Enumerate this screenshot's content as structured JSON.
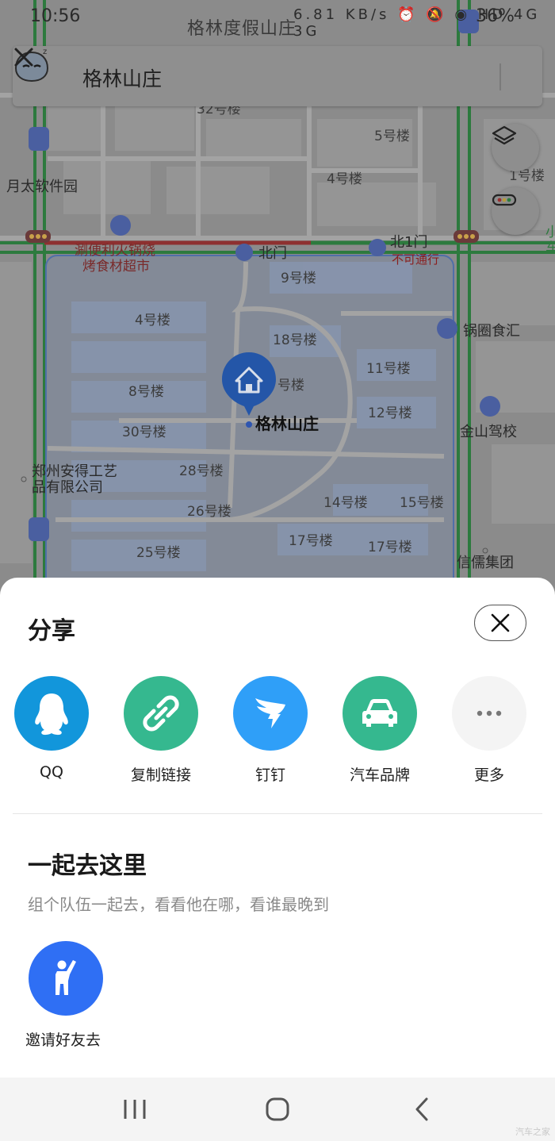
{
  "status_bar": {
    "time": "10:56",
    "map_title": "格林度假山庄",
    "icons_text": "6.81 KB/s ⏰ 🔕 ◉ HD 4G 3G",
    "battery": "36%"
  },
  "search": {
    "query": "格林山庄",
    "back_icon": "back-arrow-icon",
    "assistant_icon": "assistant-bot-icon",
    "clear_icon": "close-icon"
  },
  "map": {
    "labels": [
      {
        "text": "32号楼",
        "kind": "building"
      },
      {
        "text": "5号楼",
        "kind": "building"
      },
      {
        "text": "月太软件园",
        "kind": "poi"
      },
      {
        "text": "4号楼",
        "kind": "building"
      },
      {
        "text": "1号楼",
        "kind": "building"
      },
      {
        "text": "涮便利火锅烧",
        "kind": "red"
      },
      {
        "text": "烤食材超市",
        "kind": "red"
      },
      {
        "text": "北门",
        "kind": "poi"
      },
      {
        "text": "北1门",
        "kind": "poi"
      },
      {
        "text": "不可通行",
        "kind": "warn"
      },
      {
        "text": "9号楼",
        "kind": "building"
      },
      {
        "text": "4号楼",
        "kind": "building"
      },
      {
        "text": "18号楼",
        "kind": "building"
      },
      {
        "text": "锅圈食汇",
        "kind": "poi"
      },
      {
        "text": "11号楼",
        "kind": "building"
      },
      {
        "text": "8号楼",
        "kind": "building"
      },
      {
        "text": "号楼",
        "kind": "building"
      },
      {
        "text": "12号楼",
        "kind": "building"
      },
      {
        "text": "格林山庄",
        "kind": "selected"
      },
      {
        "text": "30号楼",
        "kind": "building"
      },
      {
        "text": "金山驾校",
        "kind": "poi"
      },
      {
        "text": "郑州安得工艺",
        "kind": "poi"
      },
      {
        "text": "品有限公司",
        "kind": "poi"
      },
      {
        "text": "28号楼",
        "kind": "building"
      },
      {
        "text": "14号楼",
        "kind": "building"
      },
      {
        "text": "15号楼",
        "kind": "building"
      },
      {
        "text": "26号楼",
        "kind": "building"
      },
      {
        "text": "17号楼",
        "kind": "building"
      },
      {
        "text": "17号楼",
        "kind": "building"
      },
      {
        "text": "25号楼",
        "kind": "building"
      },
      {
        "text": "信儒集团",
        "kind": "poi"
      },
      {
        "text": "小",
        "kind": "green"
      },
      {
        "text": "车",
        "kind": "green"
      }
    ],
    "layers_icon": "layers-icon",
    "traffic_icon": "traffic-light-icon",
    "pin_icon": "home-pin-icon"
  },
  "share_sheet": {
    "title": "分享",
    "close_icon": "close-icon",
    "items": [
      {
        "label": "QQ",
        "icon": "qq-penguin-icon",
        "color": "#1296db"
      },
      {
        "label": "复制链接",
        "icon": "link-icon",
        "color": "#35b88f"
      },
      {
        "label": "钉钉",
        "icon": "dingtalk-icon",
        "color": "#2f9ff8"
      },
      {
        "label": "汽车品牌",
        "icon": "car-icon",
        "color": "#35b88f"
      },
      {
        "label": "更多",
        "icon": "more-dots-icon",
        "color": "#f4f4f4"
      }
    ],
    "together_title": "一起去这里",
    "together_subtitle": "组个队伍一起去，看看他在哪，看谁最晚到",
    "invite_label": "邀请好友去",
    "invite_icon": "person-wave-icon",
    "invite_color": "#2f6ff4"
  },
  "nav_bar": {
    "recents_icon": "recents-icon",
    "home_icon": "home-icon",
    "back_icon": "back-icon"
  },
  "watermark": "汽车之家"
}
